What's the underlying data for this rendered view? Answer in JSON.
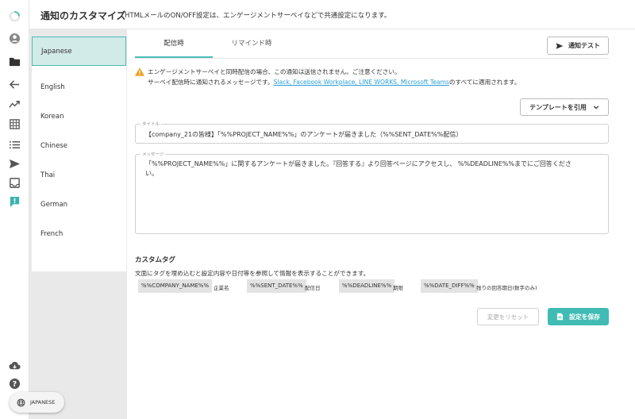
{
  "header": {
    "title": "通知のカスタマイズ",
    "subtitle": "HTMLメールのON/OFF設定は、エンゲージメントサーベイなどで共通設定になります。"
  },
  "rail": {
    "icons": [
      "loading-ring-icon",
      "user-icon",
      "folder-icon",
      "back-arrow-icon",
      "trend-icon",
      "building-icon",
      "list-icon",
      "send-icon",
      "inbox-icon",
      "alert-icon",
      "cloud-download-icon",
      "help-icon"
    ],
    "accent": "#4bbdb5",
    "alert_color": "#3bb3ac"
  },
  "languages": {
    "items": [
      {
        "label": "Japanese",
        "active": true
      },
      {
        "label": "English",
        "active": false
      },
      {
        "label": "Korean",
        "active": false
      },
      {
        "label": "Chinese",
        "active": false
      },
      {
        "label": "Thai",
        "active": false
      },
      {
        "label": "German",
        "active": false
      },
      {
        "label": "French",
        "active": false
      }
    ],
    "switcher_label": "JAPANESE"
  },
  "tabs": [
    {
      "label": "配信時",
      "active": true
    },
    {
      "label": "リマインド時",
      "active": false
    }
  ],
  "buttons": {
    "notify_test": "通知テスト",
    "template": "テンプレートを引用",
    "reset": "変更をリセット",
    "save": "設定を保存"
  },
  "warning": {
    "line1": "エンゲージメントサーベイと同時配信の場合、この通知は送信されません。ご注意ください。",
    "line2_prefix": "サーベイ配信時に通知されるメッセージです。",
    "line2_link": "Slack, Facebook Workplace, LINE WORKS, Microsoft Teams",
    "line2_suffix": "のすべてに適用されます。",
    "icon_color": "#f0a020"
  },
  "title_field": {
    "label": "タイトル",
    "value": "【company_21の皆様】「%%PROJECT_NAME%%」のアンケートが届きました（%%SENT_DATE%%配信）"
  },
  "message_field": {
    "label": "メッセージ",
    "line1": "「%%PROJECT_NAME%%」に関するアンケートが届きました。『回答する』より回答ページにアクセスし、 %%DEADLINE%%までにご回答くださ",
    "line2": "い。"
  },
  "custom_tags": {
    "title": "カスタムタグ",
    "description": "文面にタグを埋め込むと設定内容や日付等を参照して情報を表示することができます。",
    "tags": [
      {
        "tag": "%%COMPANY_NAME%%",
        "desc": "企業名"
      },
      {
        "tag": "%%SENT_DATE%%",
        "desc": "配信日"
      },
      {
        "tag": "%%DEADLINE%%",
        "desc": "期限"
      },
      {
        "tag": "%%DATE_DIFF%%",
        "desc": "残りの回答期日(数字のみ)"
      }
    ]
  }
}
